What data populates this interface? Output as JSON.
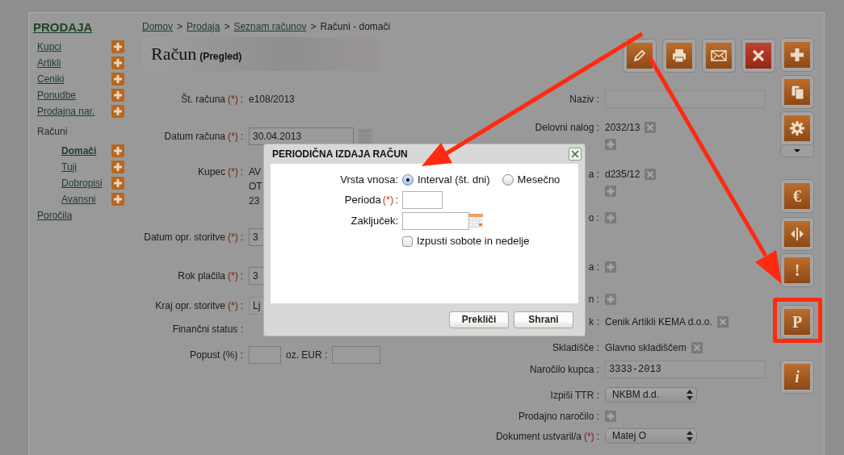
{
  "sidebar": {
    "title": "PRODAJA",
    "items": [
      {
        "label": "Kupci",
        "kind": "link",
        "addable": true
      },
      {
        "label": "Artikli",
        "kind": "link",
        "addable": true
      },
      {
        "label": "Ceniki",
        "kind": "link",
        "addable": true
      },
      {
        "label": "Ponudbe",
        "kind": "link",
        "addable": true
      },
      {
        "label": "Prodajna nar.",
        "kind": "link",
        "addable": true
      },
      {
        "label": "Računi",
        "kind": "group",
        "children": [
          {
            "label": "Domači",
            "selected": true,
            "addable": true
          },
          {
            "label": "Tuji",
            "selected": false,
            "addable": true
          },
          {
            "label": "Dobropisi",
            "selected": false,
            "addable": true
          },
          {
            "label": "Avansni",
            "selected": false,
            "addable": true
          }
        ]
      },
      {
        "label": "Poročila",
        "kind": "link",
        "addable": false
      }
    ]
  },
  "breadcrumb": [
    {
      "label": "Domov",
      "kind": "link",
      "separator": ">"
    },
    {
      "label": "Prodaja",
      "kind": "link",
      "separator": ">"
    },
    {
      "label": "Seznam računov",
      "kind": "link",
      "separator": ">"
    },
    {
      "label": "Računi - domači",
      "kind": "current"
    }
  ],
  "header": {
    "title": "Račun",
    "subtitle": "(Pregled)"
  },
  "toolbar_top": [
    {
      "kind": "edit"
    },
    {
      "kind": "print"
    },
    {
      "kind": "mail"
    },
    {
      "kind": "delete"
    }
  ],
  "toolbar_side": [
    {
      "kind": "add",
      "dropdown": false,
      "highlighted": false
    },
    {
      "kind": "copy",
      "dropdown": false,
      "highlighted": false
    },
    {
      "kind": "settings",
      "dropdown": true,
      "highlighted": false
    },
    {
      "kind": "glyph",
      "glyph": "€",
      "dropdown": false,
      "highlighted": false
    },
    {
      "kind": "split",
      "dropdown": false,
      "highlighted": false
    },
    {
      "kind": "glyph",
      "glyph": "!",
      "dropdown": false,
      "highlighted": false
    },
    {
      "kind": "glyph",
      "glyph": "P",
      "dropdown": false,
      "highlighted": true
    },
    {
      "kind": "glyph",
      "glyph": "i",
      "dropdown": false,
      "highlighted": false
    }
  ],
  "form_left": [
    {
      "kind": "text",
      "label": "Št. računa",
      "mark": "(*)",
      "suffix": ":",
      "value": "e108/2013"
    },
    {
      "kind": "date",
      "label": "Datum računa",
      "mark": "(*)",
      "suffix": ":",
      "value": "30.04.2013"
    },
    {
      "kind": "lines",
      "label": "Kupec",
      "mark": "(*)",
      "suffix": ":",
      "lines": [
        "AV",
        "OT",
        "23"
      ]
    },
    {
      "kind": "input",
      "label": "Datum opr. storitve",
      "mark": "(*)",
      "suffix": ":",
      "value": "3"
    },
    {
      "kind": "input",
      "label": "Rok plačila",
      "mark": "(*)",
      "suffix": ":",
      "value": "3"
    },
    {
      "kind": "disabled",
      "label": "Kraj opr. storitve",
      "mark": "(*)",
      "suffix": ":",
      "value": "Lj"
    },
    {
      "kind": "text",
      "label": "Finančni status :"
    },
    {
      "kind": "pair",
      "label": "Popust (%) :",
      "second_label": "oz. EUR :"
    }
  ],
  "form_right": [
    {
      "kind": "input",
      "label": "Naziv :"
    },
    {
      "kind": "tags",
      "label": "Delovni nalog :",
      "value": "2032/13"
    },
    {
      "kind": "tags",
      "label": "a :",
      "value": "d235/12"
    },
    {
      "kind": "add",
      "label": "o :"
    },
    {
      "kind": "add",
      "label": "a :"
    },
    {
      "kind": "add",
      "label": "n :"
    },
    {
      "kind": "removable",
      "label": "k :",
      "value": "Cenik Artikli KEMA d.o.o."
    },
    {
      "kind": "removable",
      "label": "Skladišče :",
      "value": "Glavno skladiščem"
    },
    {
      "kind": "input",
      "label": "Naročilo kupca :",
      "value": "3333-2013"
    },
    {
      "kind": "select",
      "label": "Izpiši TTR :",
      "value": "NKBM d.d."
    },
    {
      "kind": "add",
      "label": "Prodajno naročilo :"
    },
    {
      "kind": "select",
      "label": "Dokument ustvaril/a",
      "mark": "(*)",
      "suffix": ":",
      "value": "Matej O"
    }
  ],
  "dialog": {
    "title": "PERIODIČNA IZDAJA RAČUN",
    "fields": [
      {
        "kind": "radio",
        "label": "Vrsta vnosa:",
        "options": [
          {
            "label": "Interval (št. dni)",
            "selected": true
          },
          {
            "label": "Mesečno",
            "selected": false
          }
        ]
      },
      {
        "kind": "input",
        "label": "Perioda",
        "mark": "(*)",
        "suffix": ":"
      },
      {
        "kind": "date",
        "label": "Zaključek:"
      },
      {
        "kind": "checkbox",
        "label": "Izpusti sobote in nedelje",
        "checked": false
      }
    ],
    "buttons": [
      "Prekliči",
      "Shrani"
    ]
  }
}
